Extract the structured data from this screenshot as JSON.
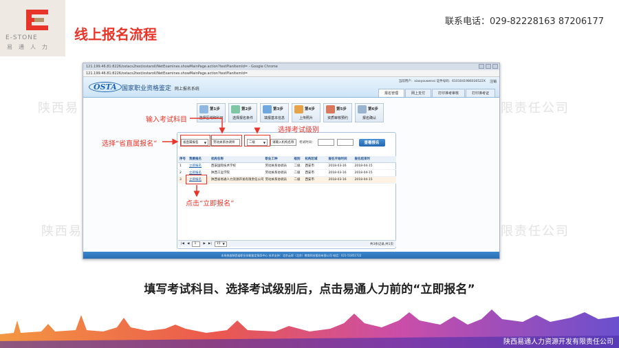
{
  "header": {
    "logo_text": "E-STONE",
    "logo_sub": "易通人力",
    "slide_title": "线上报名流程",
    "contact": "联系电话：029-82228163 87206177"
  },
  "watermark": {
    "left_text": "陕西易",
    "right_text": "限责任公司"
  },
  "browser": {
    "window_title": "121.199.46.81:8226/ostacs2test/ostaroll/NetExamines.showMainPage.action?testPlanItemId= - Google Chrome",
    "address": "121.199.46.81:8226/ostacs2test/ostaroll/NetExamines.showMainPage.action?testPlanItemId=",
    "site_logo": "OSTA",
    "site_title": "国家职业资格鉴定",
    "site_subtitle": "网上报名系统",
    "user_info": "当前用户：xiaoyouwenxi 证件号码：6101041986030522X",
    "exit": "注销",
    "top_tabs": [
      "报名管理",
      "网上支付",
      "打印准考审核",
      "打印准考证"
    ],
    "steps": [
      {
        "num": "第1步",
        "label": "选择区域和科目",
        "color": "#8fb8e0"
      },
      {
        "num": "第2步",
        "label": "选择报名条件",
        "color": "#7fc6a4"
      },
      {
        "num": "第3步",
        "label": "填报基本信息",
        "color": "#6fa8dc"
      },
      {
        "num": "第4步",
        "label": "上传照片",
        "color": "#e6a34a"
      },
      {
        "num": "第5步",
        "label": "资质审核预约",
        "color": "#d9785b"
      },
      {
        "num": "第6步",
        "label": "报名确认",
        "color": "#9ab4cf"
      }
    ],
    "filters": {
      "province": "省直属报名",
      "subject": "劳动关系协调师",
      "level": "二级",
      "org_placeholder": "请输入机构名称",
      "exam_time_label": "考试时间：",
      "search_button": "查看报名"
    },
    "table": {
      "headers": [
        "序号",
        "我要报名",
        "机构名称",
        "职业工种",
        "级别",
        "机构区域",
        "报名开始时间",
        "报名结束时"
      ],
      "rows": [
        [
          "1",
          "立即报名",
          "西安国际技术学校",
          "劳动关系协调员",
          "二级",
          "西安市",
          "2018-03-16",
          "2018-04-15"
        ],
        [
          "2",
          "立即报名",
          "陕西工运学院",
          "劳动关系协调员",
          "二级",
          "西安市",
          "2018-03-16",
          "2018-04-15"
        ],
        [
          "3",
          "立即报名",
          "陕西省易通人力资源开发有限责任公司",
          "劳动关系协调员",
          "二级",
          "西安市",
          "2018-03-16",
          "2018-04-15"
        ]
      ]
    },
    "pagination": {
      "page": "1",
      "per_page": "15",
      "summary": "共3条记录,共1页"
    },
    "footer": "本系统由陕西省职业技能鉴定指导中心 技术支持：北京云邦（北京）教育科技股份有限公司 电话：021-51851722"
  },
  "annotations": {
    "enter_subject": "输入考试科目",
    "select_province": "选择“省直属报名”",
    "select_level": "选择考试级别",
    "click_signup": "点击“立即报名”"
  },
  "caption": "填写考试科目、选择考试级别后，点击易通人力前的“立即报名”",
  "footer_company": "陕西易通人力资源开发有限责任公司",
  "colors": {
    "accent_red": "#e8352a",
    "site_blue": "#1d63b4"
  }
}
